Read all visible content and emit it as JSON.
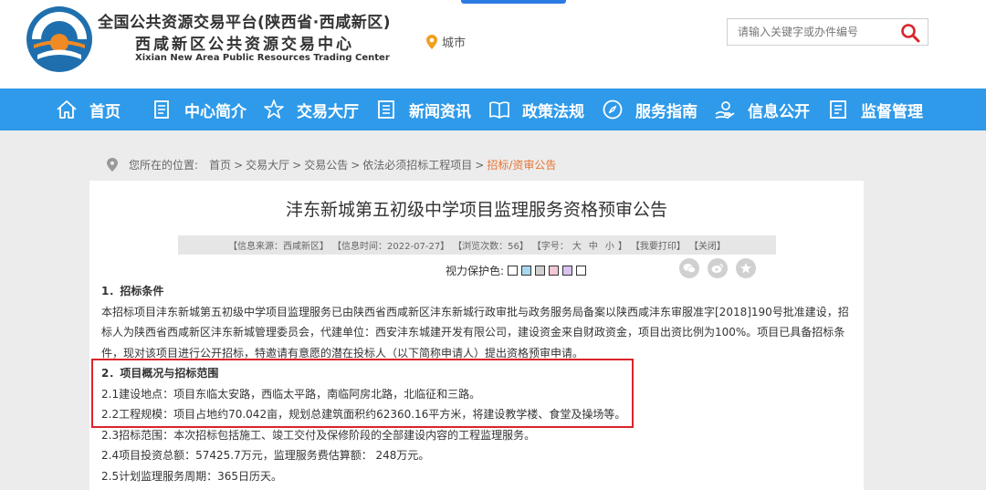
{
  "header": {
    "title_cn": "全国公共资源交易平台(陕西省·西咸新区)",
    "subtitle_cn": "西咸新区公共资源交易中心",
    "title_en": "Xixian New Area Public Resources Trading Center",
    "city_label": "城市",
    "search": {
      "placeholder": "请输入关键字或办件编号",
      "icon": "search-icon"
    },
    "colors": {
      "logo_blue": "#1f6fae",
      "logo_orange": "#f08a24"
    }
  },
  "nav": {
    "background": "#2f9ae9",
    "items": [
      {
        "label": "首页",
        "icon": "home-icon"
      },
      {
        "label": "中心简介",
        "icon": "document-icon"
      },
      {
        "label": "交易大厅",
        "icon": "star-icon"
      },
      {
        "label": "新闻资讯",
        "icon": "list-icon"
      },
      {
        "label": "政策法规",
        "icon": "book-icon"
      },
      {
        "label": "服务指南",
        "icon": "compass-icon"
      },
      {
        "label": "信息公开",
        "icon": "hand-icon"
      },
      {
        "label": "监督管理",
        "icon": "clipboard-icon"
      }
    ]
  },
  "breadcrumb": {
    "prefix": "您所在的位置:",
    "items": [
      "首页",
      "交易大厅",
      "交易公告",
      "依法必须招标工程项目"
    ],
    "current": "招标/资审公告",
    "separator": ">"
  },
  "article": {
    "title": "沣东新城第五初级中学项目监理服务资格预审公告",
    "info": {
      "source": "【信息来源：西咸新区】",
      "time": "【信息时间：2022-07-27】",
      "views": "【浏览次数：56】",
      "font_label": "【字号：",
      "font_sizes": [
        "大",
        "中",
        "小"
      ],
      "font_close": "】",
      "print": "【我要打印】",
      "close": "【关闭】"
    },
    "vision_label": "视力保护色:",
    "vision_colors": [
      "#ffffff",
      "#a8d8f0",
      "#d0d0d0",
      "#f4c7d6",
      "#d9c3ef",
      "#ffffff"
    ],
    "share_icons": [
      "wechat-icon",
      "weibo-icon",
      "favorite-icon"
    ],
    "paragraphs": [
      "1．招标条件",
      "本招标项目沣东新城第五初级中学项目监理服务已由陕西省西咸新区沣东新城行政审批与政务服务局备案以陕西咸沣东审服准字[2018]190号批准建设，招标人为陕西省西咸新区沣东新城管理委员会，代建单位：西安沣东城建开发有限公司，建设资金来自财政资金，项目出资比例为100%。项目已具备招标条件，现对该项目进行公开招标，特邀请有意愿的潜在投标人（以下简称申请人）提出资格预审申请。",
      "2．项目概况与招标范围",
      "2.1建设地点：项目东临太安路，西临太平路，南临阿房北路，北临征和三路。",
      "2.2工程规模：项目占地约70.042亩，规划总建筑面积约62360.16平方米，将建设教学楼、食堂及操场等。",
      "2.3招标范围：本次招标包括施工、竣工交付及保修阶段的全部建设内容的工程监理服务。",
      "2.4项目投资总额：57425.7万元，监理服务费估算额： 248万元。",
      "2.5计划监理服务周期：365日历天。"
    ],
    "highlight_color": "#d9252a"
  }
}
